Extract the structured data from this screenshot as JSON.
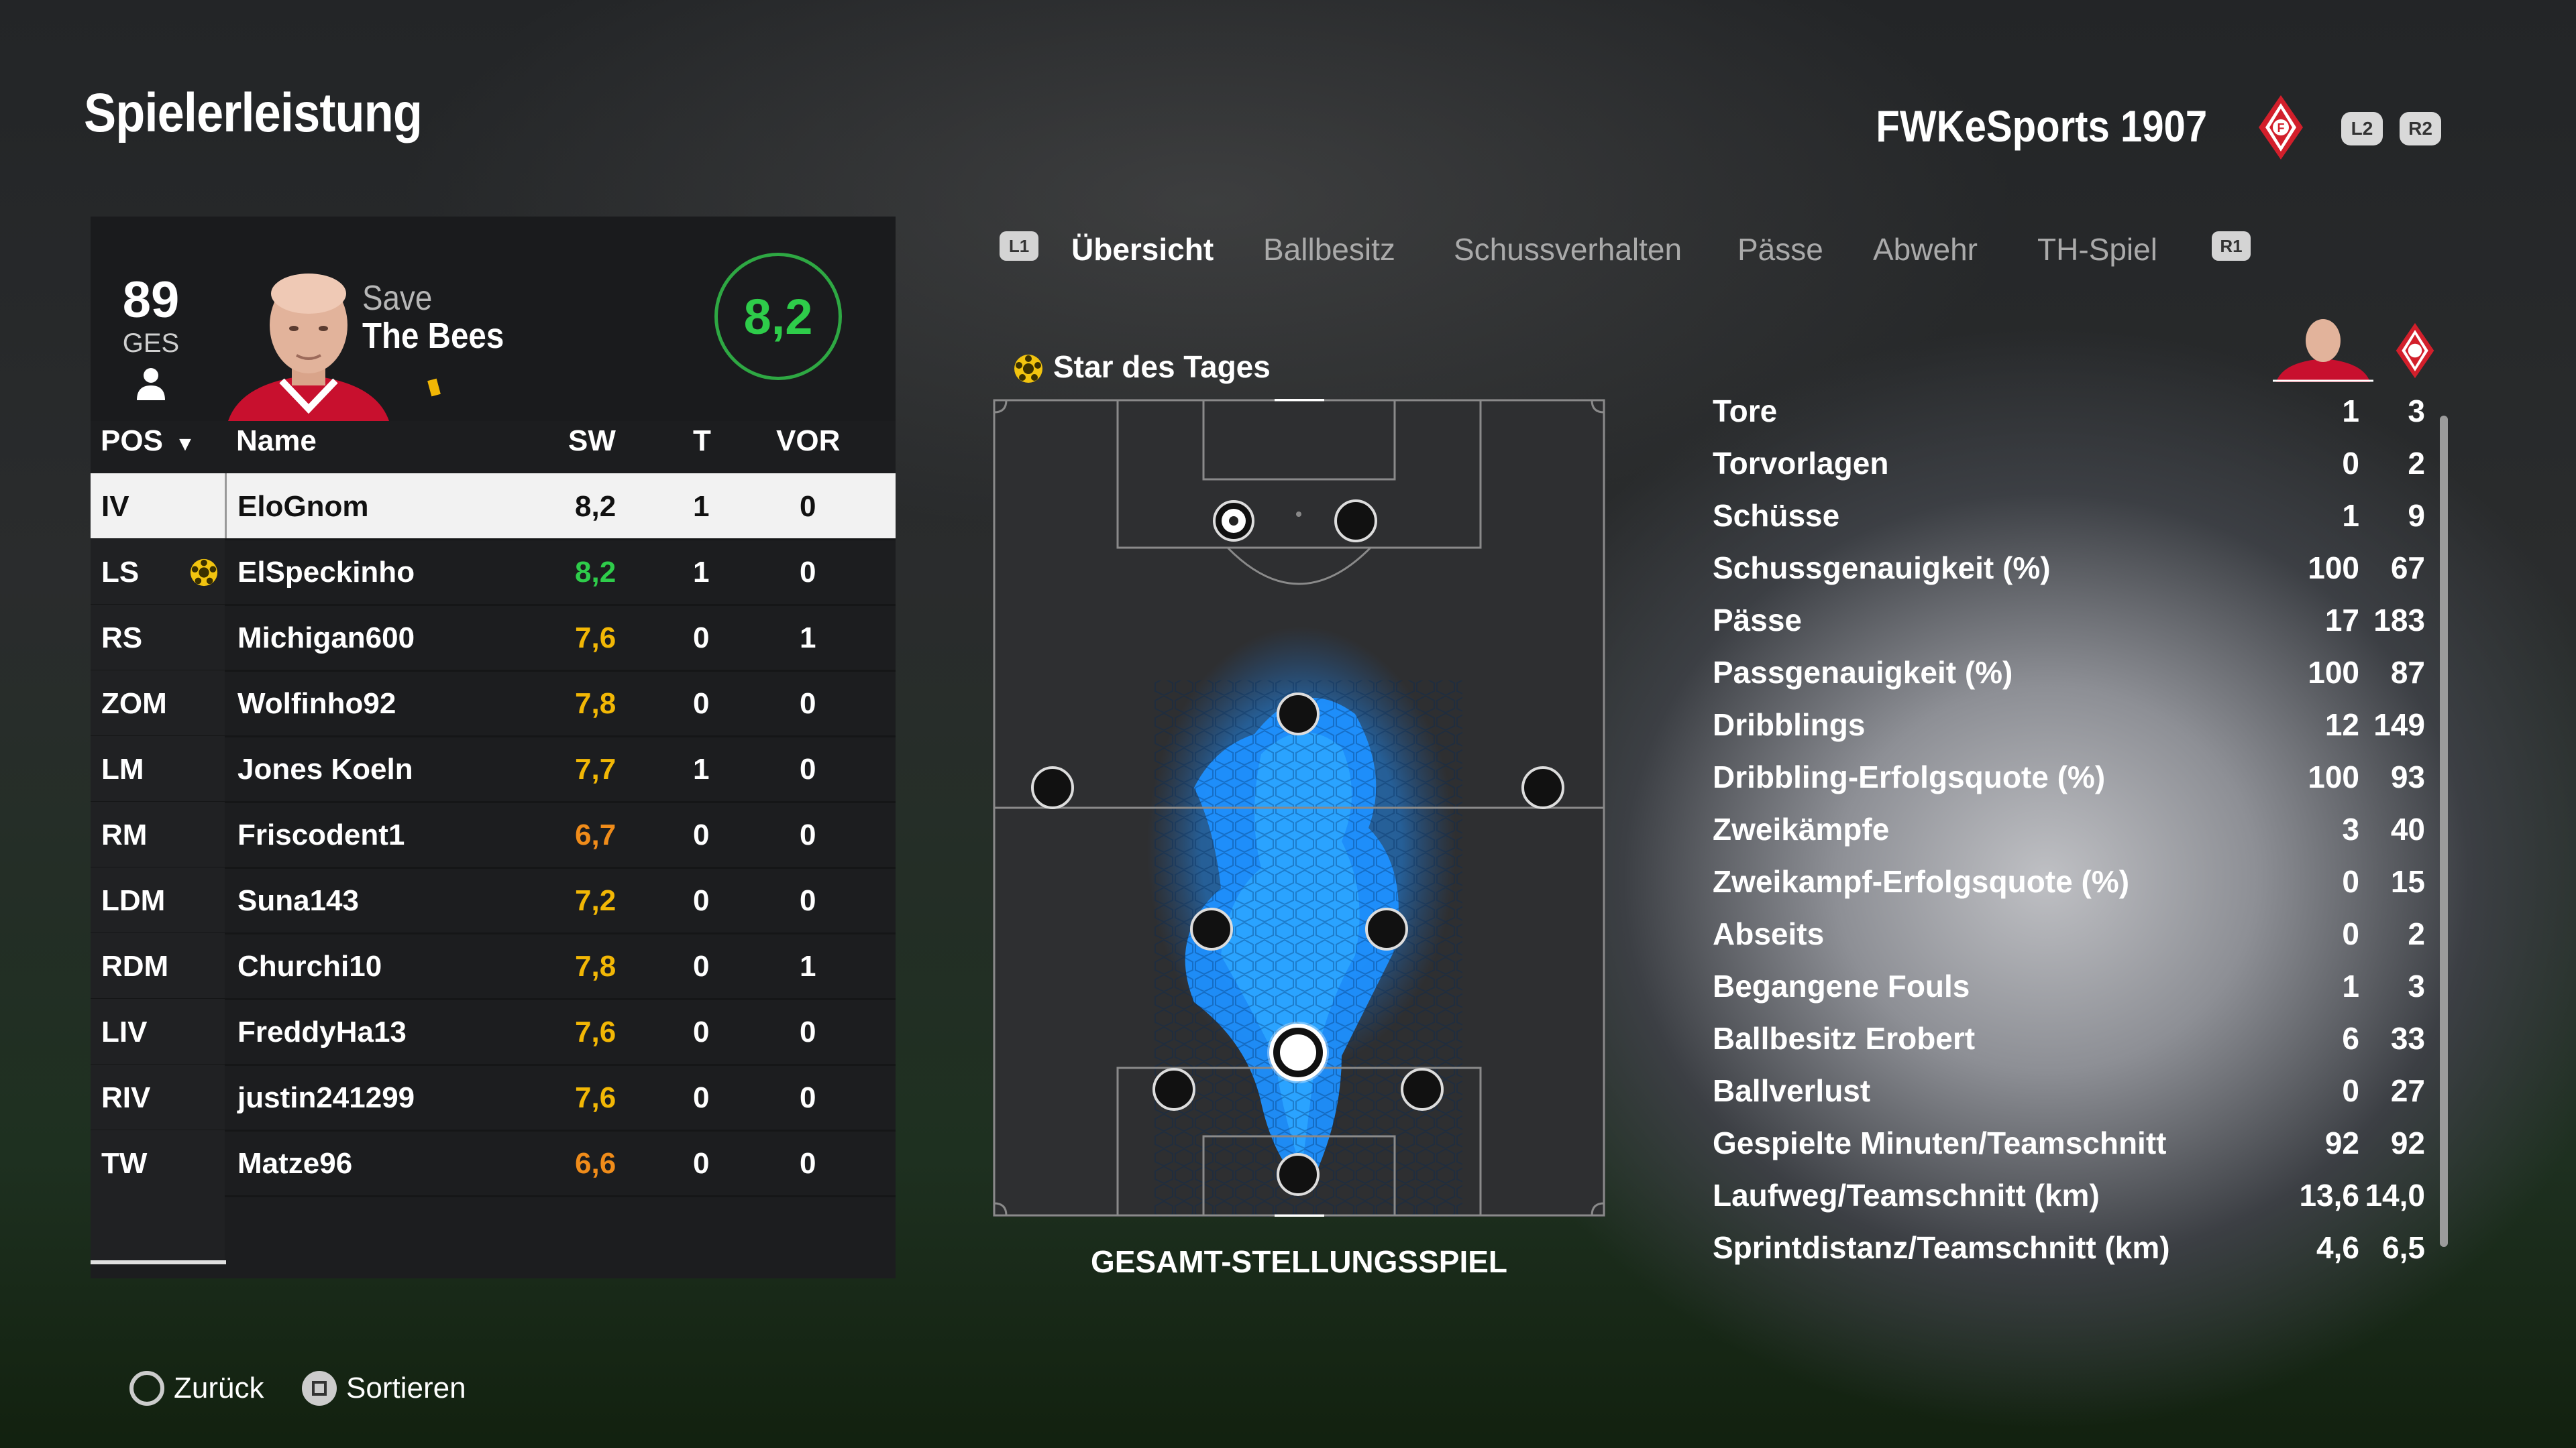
{
  "header": {
    "title": "Spielerleistung",
    "club_name": "FWKeSports 1907",
    "l2": "L2",
    "r2": "R2"
  },
  "player_card": {
    "overall": "89",
    "overall_label": "GES",
    "line1": "Save",
    "line2": "The Bees",
    "rating": "8,2"
  },
  "table": {
    "headers": {
      "pos": "POS",
      "name": "Name",
      "sw": "SW",
      "t": "T",
      "vor": "VOR"
    },
    "rows": [
      {
        "pos": "IV",
        "name": "EloGnom",
        "sw": "8,2",
        "t": "1",
        "vor": "0",
        "sw_color": "#111111",
        "star": false
      },
      {
        "pos": "LS",
        "name": "ElSpeckinho",
        "sw": "8,2",
        "t": "1",
        "vor": "0",
        "sw_color": "#2ecc4a",
        "star": true
      },
      {
        "pos": "RS",
        "name": "Michigan600",
        "sw": "7,6",
        "t": "0",
        "vor": "1",
        "sw_color": "#f2b705",
        "star": false
      },
      {
        "pos": "ZOM",
        "name": "Wolfinho92",
        "sw": "7,8",
        "t": "0",
        "vor": "0",
        "sw_color": "#f2b705",
        "star": false
      },
      {
        "pos": "LM",
        "name": "Jones Koeln",
        "sw": "7,7",
        "t": "1",
        "vor": "0",
        "sw_color": "#f2b705",
        "star": false
      },
      {
        "pos": "RM",
        "name": "Friscodent1",
        "sw": "6,7",
        "t": "0",
        "vor": "0",
        "sw_color": "#f08c1a",
        "star": false
      },
      {
        "pos": "LDM",
        "name": "Suna143",
        "sw": "7,2",
        "t": "0",
        "vor": "0",
        "sw_color": "#f2b705",
        "star": false
      },
      {
        "pos": "RDM",
        "name": "Churchi10",
        "sw": "7,8",
        "t": "0",
        "vor": "1",
        "sw_color": "#f2b705",
        "star": false
      },
      {
        "pos": "LIV",
        "name": "FreddyHa13",
        "sw": "7,6",
        "t": "0",
        "vor": "0",
        "sw_color": "#f2b705",
        "star": false
      },
      {
        "pos": "RIV",
        "name": "justin241299",
        "sw": "7,6",
        "t": "0",
        "vor": "0",
        "sw_color": "#f2b705",
        "star": false
      },
      {
        "pos": "TW",
        "name": "Matze96",
        "sw": "6,6",
        "t": "0",
        "vor": "0",
        "sw_color": "#f08c1a",
        "star": false
      }
    ]
  },
  "tabs": {
    "l1": "L1",
    "r1": "R1",
    "items": [
      "Übersicht",
      "Ballbesitz",
      "Schussverhalten",
      "Pässe",
      "Abwehr",
      "TH-Spiel"
    ],
    "active": 0
  },
  "pitch": {
    "star_label": "Star des Tages",
    "caption": "GESAMT-STELLUNGSSPIEL"
  },
  "stats": [
    {
      "label": "Tore",
      "player": "1",
      "team": "3"
    },
    {
      "label": "Torvorlagen",
      "player": "0",
      "team": "2"
    },
    {
      "label": "Schüsse",
      "player": "1",
      "team": "9"
    },
    {
      "label": "Schussgenauigkeit (%)",
      "player": "100",
      "team": "67"
    },
    {
      "label": "Pässe",
      "player": "17",
      "team": "183"
    },
    {
      "label": "Passgenauigkeit (%)",
      "player": "100",
      "team": "87"
    },
    {
      "label": "Dribblings",
      "player": "12",
      "team": "149"
    },
    {
      "label": "Dribbling-Erfolgsquote (%)",
      "player": "100",
      "team": "93"
    },
    {
      "label": "Zweikämpfe",
      "player": "3",
      "team": "40"
    },
    {
      "label": "Zweikampf-Erfolgsquote (%)",
      "player": "0",
      "team": "15"
    },
    {
      "label": "Abseits",
      "player": "0",
      "team": "2"
    },
    {
      "label": "Begangene Fouls",
      "player": "1",
      "team": "3"
    },
    {
      "label": "Ballbesitz Erobert",
      "player": "6",
      "team": "33"
    },
    {
      "label": "Ballverlust",
      "player": "0",
      "team": "27"
    },
    {
      "label": "Gespielte Minuten/Teamschnitt",
      "player": "92",
      "team": "92"
    },
    {
      "label": "Laufweg/Teamschnitt (km)",
      "player": "13,6",
      "team": "14,0"
    },
    {
      "label": "Sprintdistanz/Teamschnitt (km)",
      "player": "4,6",
      "team": "6,5"
    }
  ],
  "footer": {
    "back": "Zurück",
    "sort": "Sortieren"
  },
  "colors": {
    "accent_green": "#2ecc4a",
    "rating_yellow": "#f2b705",
    "rating_orange": "#f08c1a",
    "heatmap_blue": "#1e90ff",
    "club_red": "#d21f2b"
  }
}
